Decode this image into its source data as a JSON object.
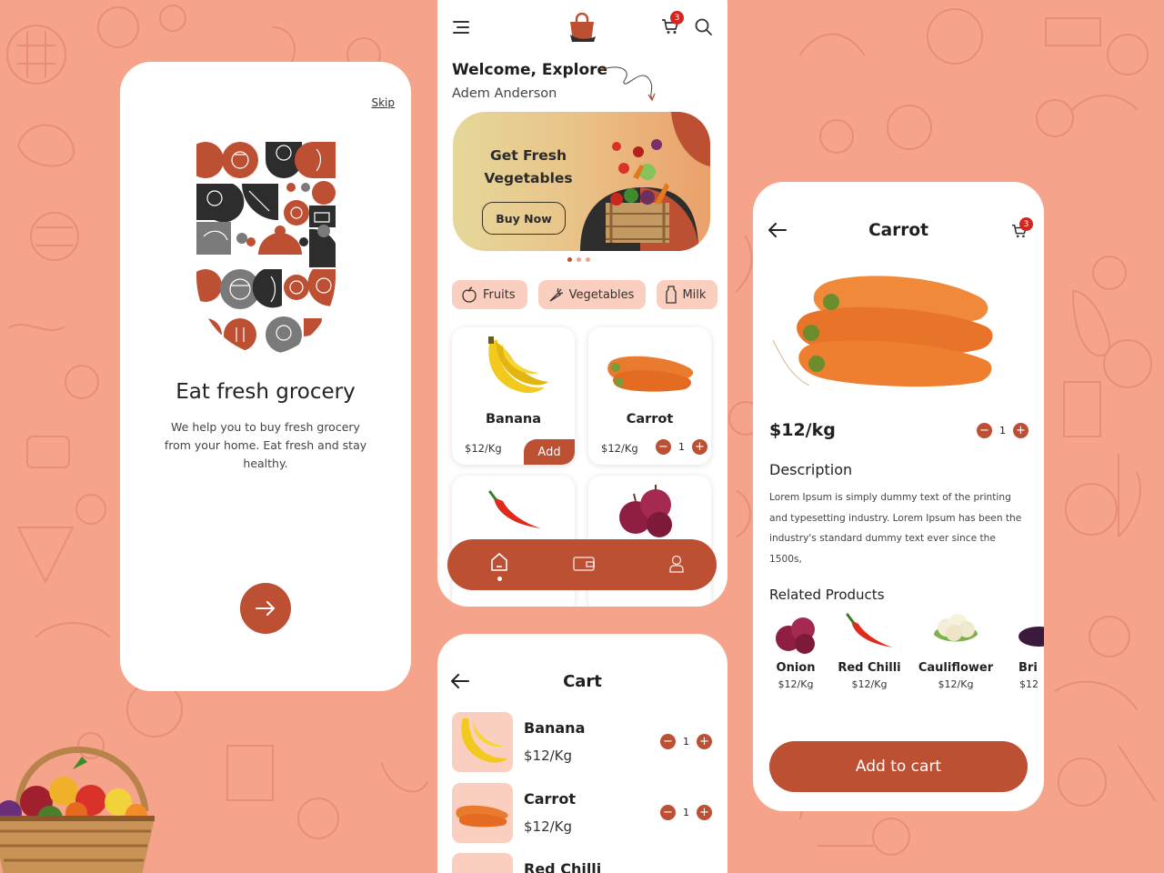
{
  "theme": {
    "background": "#f5a48b",
    "accent": "#bd4f33",
    "chip": "#fbcfbf",
    "badge": "#d6241f"
  },
  "onboarding": {
    "skip_label": "Skip",
    "title": "Eat fresh grocery",
    "subtitle": "We help you to buy fresh grocery from your home. Eat fresh and stay healthy.",
    "next_icon": "arrow-right-icon"
  },
  "home": {
    "cart_count": "3",
    "welcome": "Welcome, Explore",
    "user_name": "Adem Anderson",
    "banner": {
      "title": "Get Fresh Vegetables",
      "button": "Buy Now",
      "slides": 3,
      "active_slide": 1
    },
    "categories": [
      {
        "label": "Fruits",
        "icon": "apple-icon"
      },
      {
        "label": "Vegetables",
        "icon": "carrot-icon"
      },
      {
        "label": "Milk",
        "icon": "milk-bottle-icon"
      }
    ],
    "products": [
      {
        "name": "Banana",
        "price": "$12/Kg",
        "action": "Add"
      },
      {
        "name": "Carrot",
        "price": "$12/Kg",
        "qty": "1"
      },
      {
        "name": "",
        "image": "red-chilli"
      },
      {
        "name": "",
        "image": "onion"
      }
    ],
    "nav": [
      "home-icon",
      "wallet-icon",
      "user-icon"
    ]
  },
  "cart": {
    "title": "Cart",
    "items": [
      {
        "name": "Banana",
        "price": "$12/Kg",
        "qty": "1"
      },
      {
        "name": "Carrot",
        "price": "$12/Kg",
        "qty": "1"
      },
      {
        "name": "Red Chilli",
        "price": "",
        "qty": ""
      }
    ]
  },
  "detail": {
    "title": "Carrot",
    "cart_count": "3",
    "price": "$12/kg",
    "qty": "1",
    "description_heading": "Description",
    "description": "Lorem Ipsum is simply dummy text of the printing and typesetting industry. Lorem Ipsum has been the industry's standard dummy text ever since the 1500s,",
    "related_heading": "Related Products",
    "related": [
      {
        "name": "Onion",
        "price": "$12/Kg"
      },
      {
        "name": "Red Chilli",
        "price": "$12/Kg"
      },
      {
        "name": "Cauliflower",
        "price": "$12/Kg"
      },
      {
        "name": "Bri",
        "price": "$12"
      }
    ],
    "add_to_cart": "Add to cart"
  }
}
